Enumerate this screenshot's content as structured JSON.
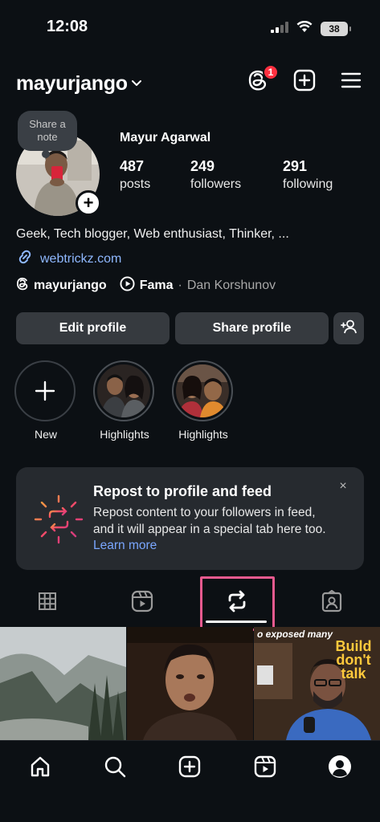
{
  "status_bar": {
    "time": "12:08",
    "battery": "38",
    "signal_icon": "cellular-signal-icon",
    "wifi_icon": "wifi-icon"
  },
  "header": {
    "username": "mayurjango",
    "threads_badge": "1",
    "icons": [
      "threads-icon",
      "create-post-icon",
      "menu-icon"
    ]
  },
  "profile": {
    "note_bubble": "Share a note",
    "display_name": "Mayur Agarwal",
    "stats": [
      {
        "value": "487",
        "label": "posts"
      },
      {
        "value": "249",
        "label": "followers"
      },
      {
        "value": "291",
        "label": "following"
      }
    ],
    "bio": "Geek, Tech blogger, Web enthusiast, Thinker, ...",
    "link": "webtrickz.com",
    "threads_handle": "mayurjango",
    "music_title": "Fama",
    "music_separator": "·",
    "music_artist": "Dan Korshunov"
  },
  "actions": {
    "edit_profile": "Edit profile",
    "share_profile": "Share profile"
  },
  "highlights": [
    {
      "label": "New"
    },
    {
      "label": "Highlights"
    },
    {
      "label": "Highlights"
    }
  ],
  "repost_card": {
    "title": "Repost to profile and feed",
    "body": "Repost content to your followers in feed, and it will appear in a special tab here too.",
    "learn_more": "Learn more",
    "close": "×"
  },
  "tabs": [
    {
      "name": "grid",
      "icon": "grid-icon"
    },
    {
      "name": "reels",
      "icon": "reels-icon"
    },
    {
      "name": "reposts",
      "icon": "repost-icon",
      "active": true
    },
    {
      "name": "tagged",
      "icon": "tagged-icon"
    }
  ],
  "grid_posts": [
    {
      "caption": ""
    },
    {
      "caption": ""
    },
    {
      "caption": "o exposed many",
      "sign": "Build don't talk"
    }
  ],
  "bottom_nav": [
    "home-icon",
    "search-icon",
    "create-icon",
    "reels-icon",
    "profile-icon"
  ],
  "colors": {
    "background": "#0c1014",
    "button": "#363a3f",
    "card": "#262a2f",
    "link": "#8fb8ff",
    "badge": "#ff3040",
    "tab_highlight": "#e85a8f"
  }
}
